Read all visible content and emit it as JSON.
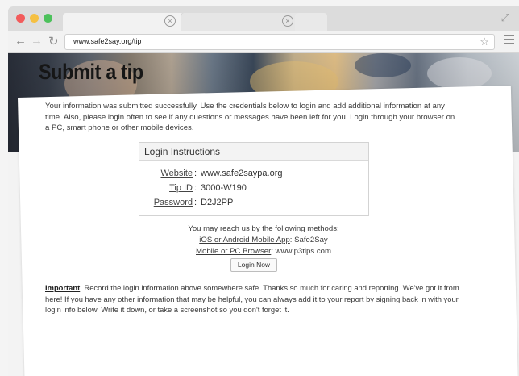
{
  "browser": {
    "url": "www.safe2say.org/tip"
  },
  "page": {
    "title": "Submit a tip",
    "intro": "Your information was submitted successfully. Use the credentials below to login and add additional information at any time. Also, please login often to see if any questions or messages have been left for you. Login through your browser on a PC, smart phone or other mobile devices.",
    "login_box": {
      "heading": "Login Instructions",
      "rows": [
        {
          "label": "Website",
          "value": "www.safe2saypa.org"
        },
        {
          "label": "Tip ID",
          "value": "3000-W190"
        },
        {
          "label": "Password",
          "value": "D2J2PP"
        }
      ]
    },
    "methods": {
      "intro": "You may reach us by the following methods:",
      "app_label": "iOS or Android Mobile App",
      "app_value": "Safe2Say",
      "browser_label": "Mobile or PC Browser",
      "browser_value": "www.p3tips.com"
    },
    "login_button": "Login Now",
    "important_label": "Important",
    "important_text": ": Record the login information above somewhere safe. Thanks so much for caring and reporting. We've got it from here! If you have any other information that may be helpful, you can always add it to your report by signing back in with your login info below. Write it down, or take a screenshot so you don't forget it."
  }
}
